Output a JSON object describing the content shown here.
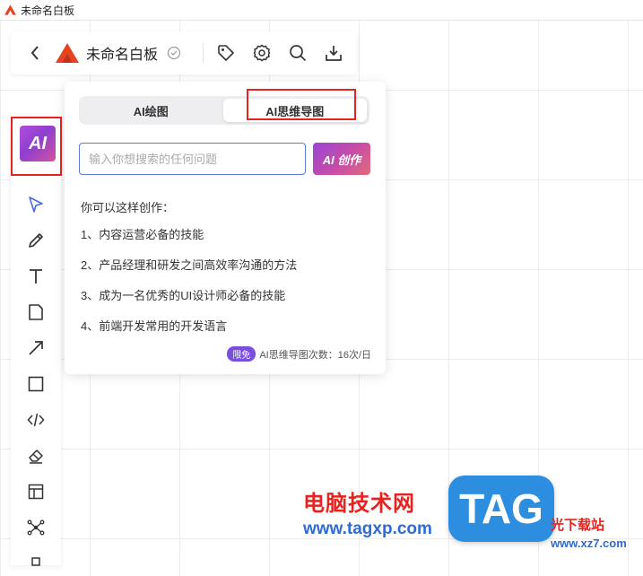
{
  "window": {
    "title": "未命名白板"
  },
  "header": {
    "doc_title": "未命名白板"
  },
  "ai_button": {
    "label": "AI"
  },
  "panel": {
    "tabs": [
      {
        "label": "AI绘图",
        "active": false
      },
      {
        "label": "AI思维导图",
        "active": true
      }
    ],
    "search": {
      "value": "",
      "placeholder": "输入你想搜索的任何问题"
    },
    "create_button": "AI 创作",
    "hint_title": "你可以这样创作：",
    "hints": [
      "1、内容运营必备的技能",
      "2、产品经理和研发之间高效率沟通的方法",
      "3、成为一名优秀的UI设计师必备的技能",
      "4、前端开发常用的开发语言"
    ],
    "quota": {
      "badge": "限免",
      "text": "AI思维导图次数：16次/日"
    }
  },
  "watermark": {
    "cn_text": "电脑技术网",
    "url": "www.tagxp.com",
    "tag": "TAG",
    "site": "光下载站",
    "site_url": "www.xz7.com"
  },
  "colors": {
    "accent": "#9a46d6",
    "highlight_border": "#e8231f",
    "input_border": "#5b7bd6",
    "badge": "#7a4fe0"
  }
}
